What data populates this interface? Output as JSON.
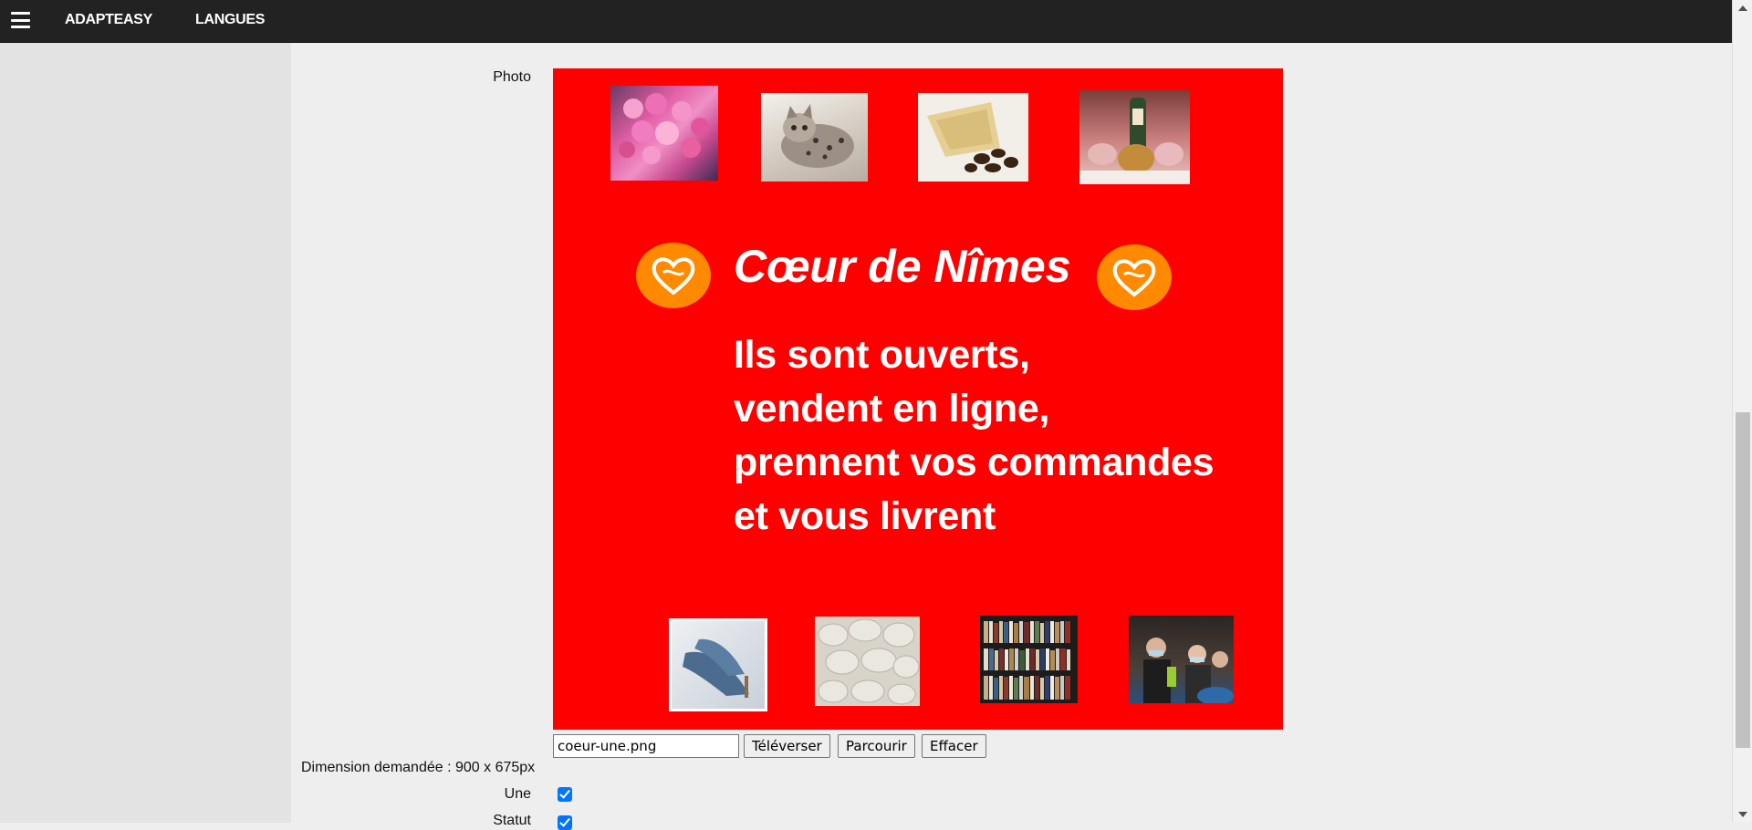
{
  "header": {
    "menu_icon": "hamburger-icon",
    "nav": [
      {
        "label": "ADAPTEASY"
      },
      {
        "label": "LANGUES"
      }
    ]
  },
  "form": {
    "photo_label": "Photo",
    "photo": {
      "alt": "Cœur de Nîmes banner",
      "background_color": "#ff0000",
      "banner_title": "Cœur de Nîmes",
      "banner_lines": [
        "Ils sont ouverts,",
        "vendent en ligne,",
        "prennent vos commandes",
        "et vous livrent"
      ],
      "badge_color": "#ff8a00"
    },
    "file_value": "coeur-une.png",
    "upload_button": "Téléverser",
    "browse_button": "Parcourir",
    "clear_button": "Effacer",
    "dimension_label": "Dimension demandée : 900 x 675px",
    "une_label": "Une",
    "une_checked": true,
    "statut_label": "Statut",
    "statut_checked": true
  }
}
